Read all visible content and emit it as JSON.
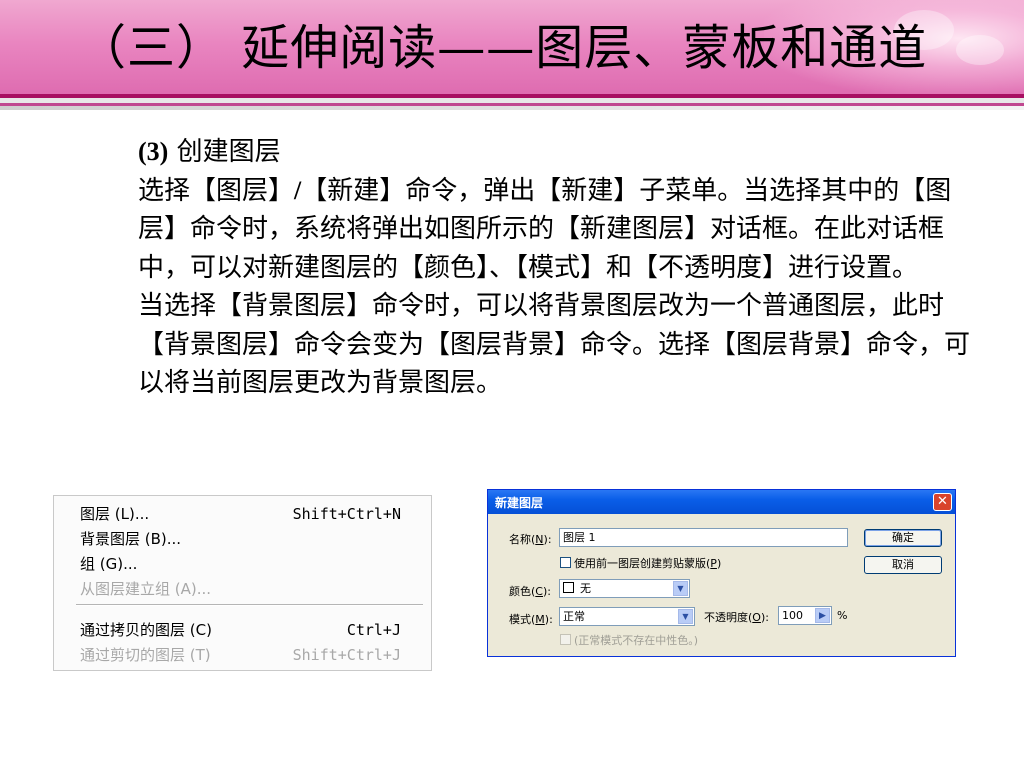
{
  "slide": {
    "title": "（三） 延伸阅读——图层、蒙板和通道"
  },
  "body": {
    "heading_num": "(3)",
    "heading_text": " 创建图层",
    "p1_a": "选择【图层】",
    "p1_slash": "/",
    "p1_b": "【新建】命令，弹出【新建】子菜单。当选择其中的【图层】命令时，系统将弹出如图所示的【新建图层】对话框。在此对话框中，可以对新建图层的【颜色】、【模式】和【不透明度】进行设置。",
    "p2": "当选择【背景图层】命令时，可以将背景图层改为一个普通图层，此时【背景图层】命令会变为【图层背景】命令。选择【图层背景】命令，可以将当前图层更改为背景图层。"
  },
  "menu": {
    "items": [
      {
        "label": "图层 (L)...",
        "shortcut": "Shift+Ctrl+N",
        "enabled": true
      },
      {
        "label": "背景图层 (B)...",
        "shortcut": "",
        "enabled": true
      },
      {
        "label": "组 (G)...",
        "shortcut": "",
        "enabled": true
      },
      {
        "label": "从图层建立组 (A)...",
        "shortcut": "",
        "enabled": false
      },
      {
        "label": "通过拷贝的图层 (C)",
        "shortcut": "Ctrl+J",
        "enabled": true
      },
      {
        "label": "通过剪切的图层 (T)",
        "shortcut": "Shift+Ctrl+J",
        "enabled": false
      }
    ]
  },
  "dialog": {
    "title": "新建图层",
    "name_label_pre": "名称(",
    "name_label_key": "N",
    "name_label_post": "):",
    "name_value": "图层 1",
    "clip_label_pre": "使用前一图层创建剪贴蒙版(",
    "clip_label_key": "P",
    "clip_label_post": ")",
    "color_label_pre": "颜色(",
    "color_label_key": "C",
    "color_label_post": "):",
    "color_value": "无",
    "mode_label_pre": "模式(",
    "mode_label_key": "M",
    "mode_label_post": "):",
    "mode_value": "正常",
    "opacity_label_pre": "不透明度(",
    "opacity_label_key": "O",
    "opacity_label_post": "):",
    "opacity_value": "100",
    "percent": "%",
    "neutral_label": "(正常模式不存在中性色。)",
    "ok_label": "确定",
    "cancel_label": "取消",
    "close_glyph": "✕"
  },
  "colors": {
    "banner_pink": "#de6bb0",
    "stripe_dark": "#a80f62",
    "xp_titlebar": "#0a5ee8"
  }
}
